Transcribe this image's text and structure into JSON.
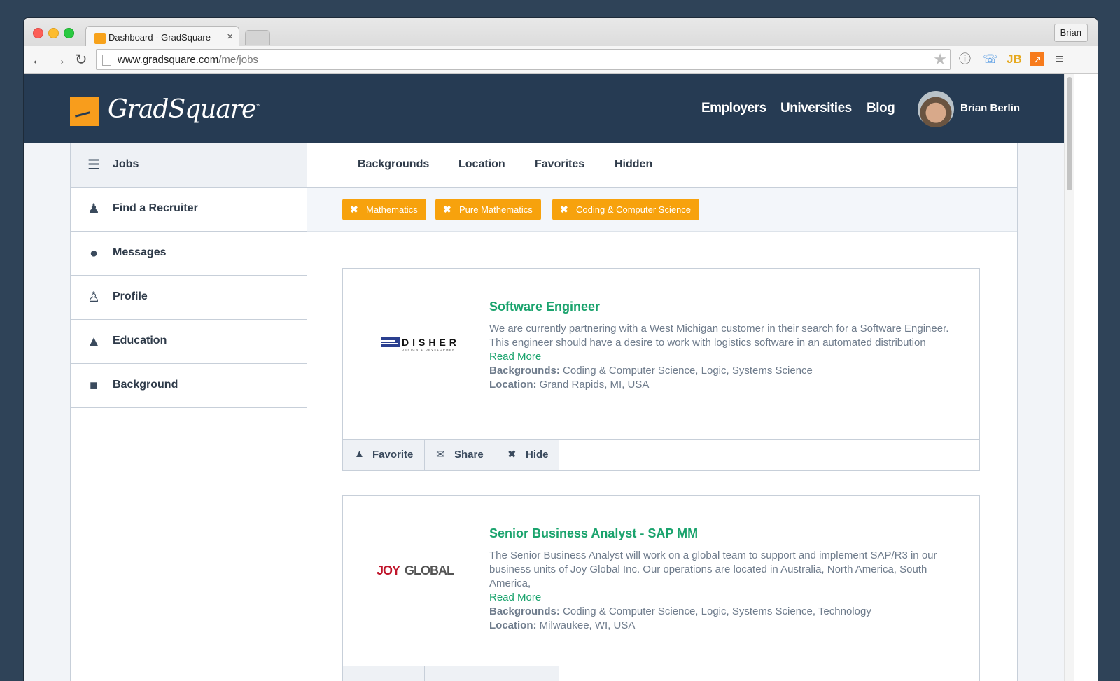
{
  "browser": {
    "tab_title": "Dashboard - GradSquare",
    "tab_close": "×",
    "profile": "Brian",
    "url_host": "www.gradsquare.com",
    "url_path": "/me/jobs"
  },
  "site": {
    "logo": "GradSquare",
    "logo_tm": "™",
    "nav": [
      "Employers",
      "Universities",
      "Blog"
    ],
    "user_name": "Brian Berlin"
  },
  "sidebar": {
    "items": [
      {
        "label": "Jobs",
        "icon": "jobs-list-icon",
        "active": true
      },
      {
        "label": "Find a Recruiter",
        "icon": "users-icon"
      },
      {
        "label": "Messages",
        "icon": "speech-bubble-icon"
      },
      {
        "label": "Profile",
        "icon": "user-icon"
      },
      {
        "label": "Education",
        "icon": "graduation-cap-icon"
      },
      {
        "label": "Background",
        "icon": "briefcase-icon"
      }
    ]
  },
  "filters": {
    "tabs": [
      "Backgrounds",
      "Location",
      "Favorites",
      "Hidden"
    ],
    "chips": [
      "Mathematics",
      "Pure Mathematics",
      "Coding & Computer Science"
    ]
  },
  "jobs": [
    {
      "company": "DISHER",
      "company_sub": "DESIGN & DEVELOPMENT",
      "title": "Software Engineer",
      "description": "We are currently partnering with a West Michigan customer in their search for a Software Engineer. This engineer should have a desire to work with logistics software in an automated distribution",
      "read_more": "Read More",
      "backgrounds_label": "Backgrounds:",
      "backgrounds": "Coding & Computer Science, Logic, Systems Science",
      "location_label": "Location:",
      "location": "Grand Rapids, MI, USA"
    },
    {
      "company_part1": "JOY",
      "company_part2": "GLOBAL",
      "title": "Senior Business Analyst - SAP MM",
      "description": "The Senior Business Analyst will work on a global team to support and implement SAP/R3 in our business units of Joy Global Inc. Our operations are located in Australia, North America, South America,",
      "read_more": "Read More",
      "backgrounds_label": "Backgrounds:",
      "backgrounds": "Coding & Computer Science, Logic, Systems Science, Technology",
      "location_label": "Location:",
      "location": "Milwaukee, WI, USA"
    }
  ],
  "actions": {
    "favorite": "Favorite",
    "share": "Share",
    "hide": "Hide"
  },
  "colors": {
    "brand_orange": "#f7a20d",
    "header_navy": "#263b53",
    "link_green": "#1aa36d"
  }
}
